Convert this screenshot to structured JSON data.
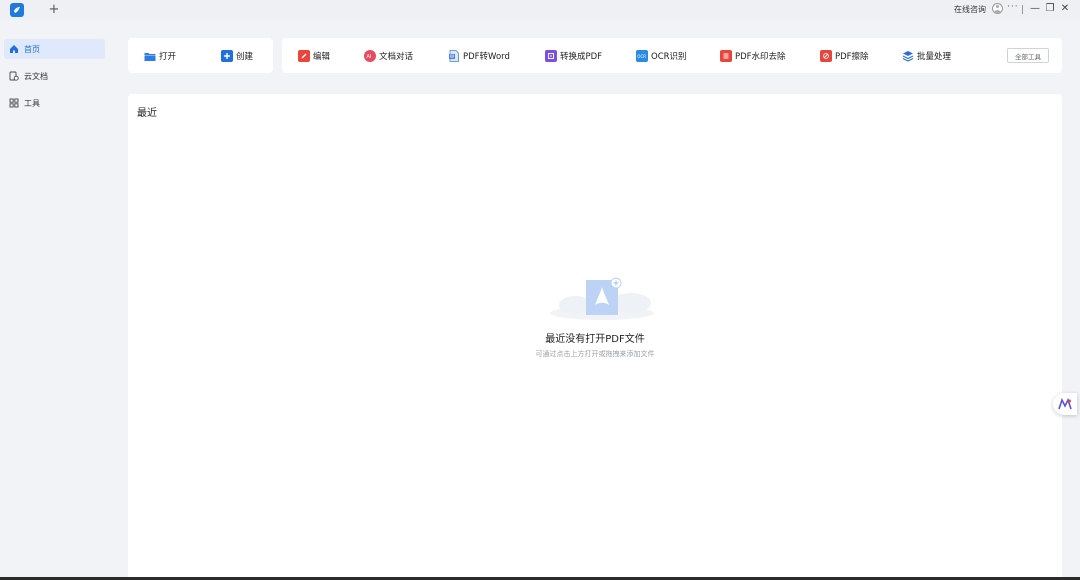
{
  "titlebar": {
    "new_tab": "+",
    "online_consult": "在线咨询",
    "more": "···",
    "minimize": "—",
    "maximize": "❐",
    "close": "✕"
  },
  "sidebar": {
    "items": [
      {
        "label": "首页",
        "icon": "home-icon",
        "active": true
      },
      {
        "label": "云文档",
        "icon": "cloud-doc-icon",
        "active": false
      },
      {
        "label": "工具",
        "icon": "tools-grid-icon",
        "active": false
      }
    ]
  },
  "toolbar": {
    "left": [
      {
        "label": "打开",
        "icon": "folder-icon",
        "color": "#2f7be5"
      },
      {
        "label": "创建",
        "icon": "plus-icon",
        "color": "#1f6fe0"
      }
    ],
    "right": [
      {
        "label": "编辑",
        "icon": "pencil-icon",
        "color": "#e8463c"
      },
      {
        "label": "文档对话",
        "icon": "ai-chat-icon",
        "color": "#e84a5f"
      },
      {
        "label": "PDF转Word",
        "icon": "word-icon",
        "color": "#4a7fe0"
      },
      {
        "label": "转换成PDF",
        "icon": "convert-icon",
        "color": "#7b4fe0"
      },
      {
        "label": "OCR识别",
        "icon": "ocr-icon",
        "color": "#2a8be6"
      },
      {
        "label": "PDF水印去除",
        "icon": "watermark-icon",
        "color": "#e8463c"
      },
      {
        "label": "PDF擦除",
        "icon": "eraser-icon",
        "color": "#e8463c"
      },
      {
        "label": "批量处理",
        "icon": "layers-icon",
        "color": "#2a6fd8"
      }
    ],
    "all_tools": "全部工具"
  },
  "main": {
    "section_title": "最近",
    "empty_title": "最近没有打开PDF文件",
    "empty_hint": "可通过点击上方打开或拖拽来添加文件"
  }
}
